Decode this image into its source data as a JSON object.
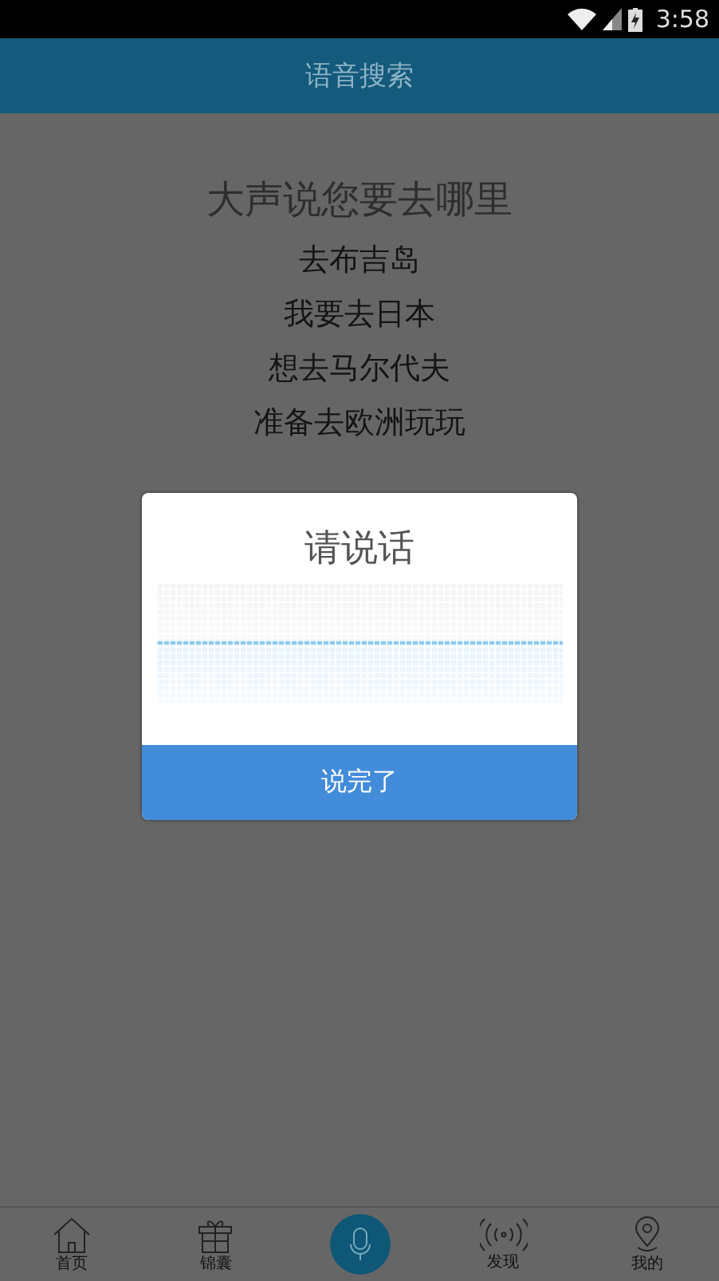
{
  "status_bar": {
    "time": "3:58"
  },
  "header": {
    "title": "语音搜索"
  },
  "prompt": {
    "heading": "大声说您要去哪里",
    "examples": [
      "去布吉岛",
      "我要去日本",
      "想去马尔代夫",
      "准备去欧洲玩玩"
    ]
  },
  "dialog": {
    "title": "请说话",
    "button": "说完了"
  },
  "nav": [
    {
      "kind": "home",
      "label": "首页"
    },
    {
      "kind": "gift",
      "label": "锦囊"
    },
    {
      "kind": "mic"
    },
    {
      "kind": "broadcast",
      "label": "发现"
    },
    {
      "kind": "location",
      "label": "我的"
    }
  ]
}
